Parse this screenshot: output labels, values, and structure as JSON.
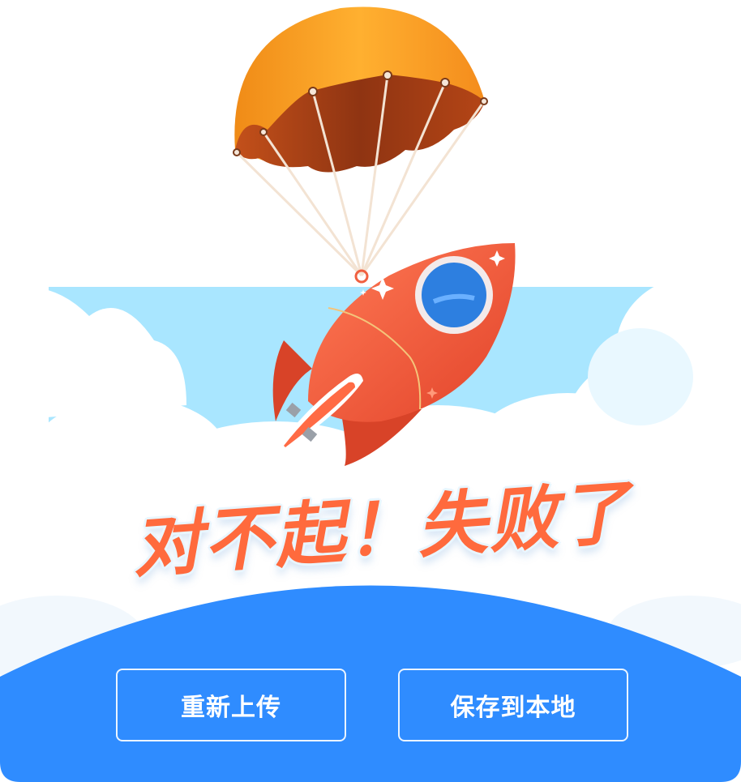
{
  "status": {
    "headline": "对不起！失败了"
  },
  "actions": {
    "reupload_label": "重新上传",
    "save_local_label": "保存到本地"
  },
  "colors": {
    "primary_blue": "#2f8cff",
    "sky": "#a9e6ff",
    "rocket": "#f05a3a",
    "parachute": "#f49b23",
    "headline_text": "#ff6a3d"
  },
  "illustration": {
    "icons": [
      "parachute-icon",
      "rocket-icon",
      "cloud-icon"
    ]
  }
}
